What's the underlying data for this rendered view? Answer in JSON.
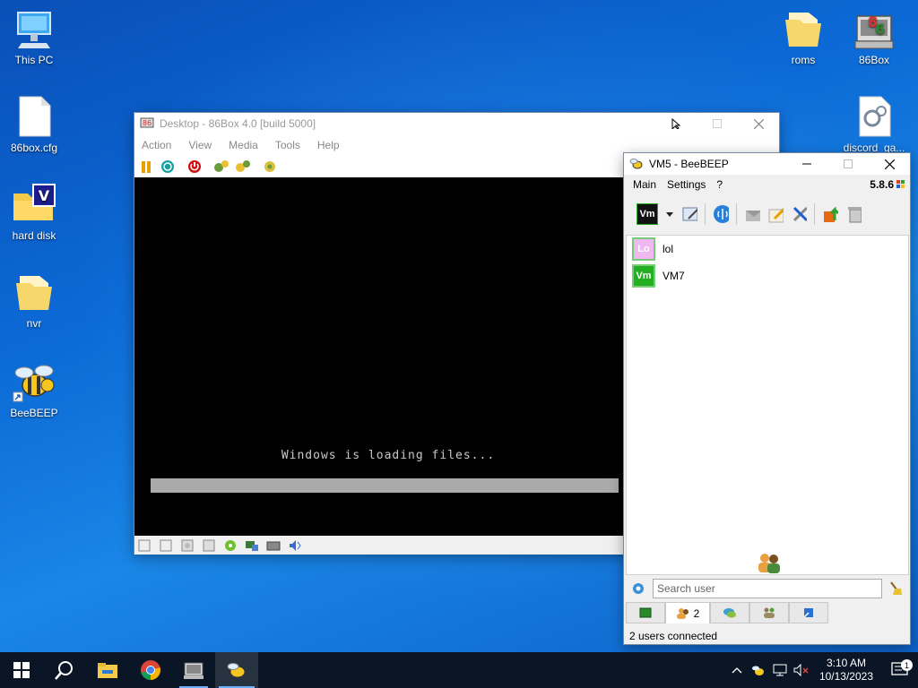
{
  "desktop": {
    "icons": [
      {
        "label": "This PC",
        "icon": "this-pc-icon"
      },
      {
        "label": "86box.cfg",
        "icon": "file-icon"
      },
      {
        "label": "hard disk",
        "icon": "folder-icon"
      },
      {
        "label": "nvr",
        "icon": "folder-icon"
      },
      {
        "label": "BeeBEEP",
        "icon": "beebeep-icon"
      },
      {
        "label": "roms",
        "icon": "folder-icon"
      },
      {
        "label": "86Box",
        "icon": "86box-icon"
      },
      {
        "label": "discord_ga...",
        "icon": "settings-file-icon"
      }
    ]
  },
  "box86": {
    "title": "Desktop - 86Box 4.0 [build 5000]",
    "menu": [
      "Action",
      "View",
      "Media",
      "Tools",
      "Help"
    ],
    "screen_text": "Windows is loading files...",
    "loading_progress": 1.0
  },
  "beebeep": {
    "title": "VM5 - BeeBEEP",
    "menu": [
      "Main",
      "Settings",
      "?"
    ],
    "version": "5.8.6",
    "my_avatar_text": "Vm",
    "users": [
      {
        "avatar": "Lo",
        "name": "lol",
        "color": "#f0b8f0"
      },
      {
        "avatar": "Vm",
        "name": "VM7",
        "color": "#22b022"
      }
    ],
    "search_placeholder": "Search user",
    "users_tab_count": "2",
    "status": "2 users connected"
  },
  "taskbar": {
    "time": "3:10 AM",
    "date": "10/13/2023",
    "notifications": "1"
  },
  "colors": {
    "desktop": "#0b6ad6",
    "taskbar": "#0a1626",
    "accent": "#6ab0ff"
  }
}
